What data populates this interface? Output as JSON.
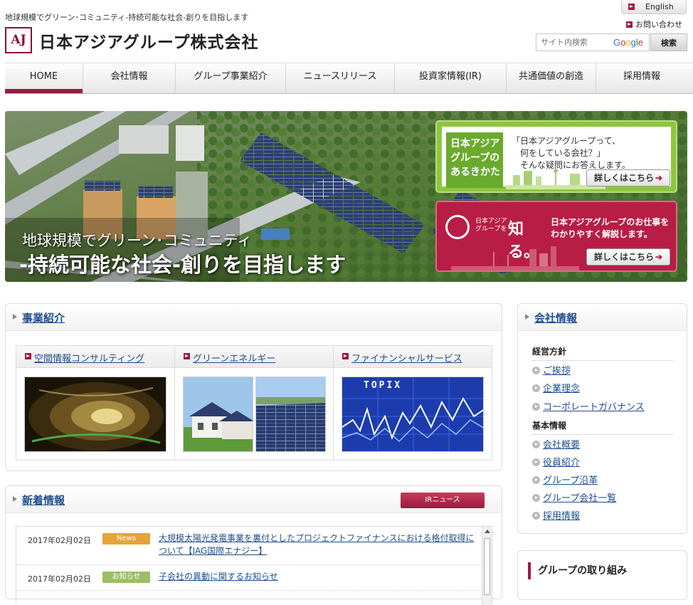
{
  "header": {
    "tagline": "地球規模でグリーン･コミュニティ-持続可能な社会-創りを目指します",
    "logo_mark": "AJ",
    "company_name": "日本アジアグループ株式会社",
    "language_button": "English",
    "contact_link": "お問い合わせ",
    "search": {
      "placeholder": "サイト内検索",
      "provider": "Google",
      "button": "検索"
    }
  },
  "nav": {
    "items": [
      {
        "label": "HOME",
        "active": true
      },
      {
        "label": "会社情報"
      },
      {
        "label": "グループ事業紹介"
      },
      {
        "label": "ニュースリリース"
      },
      {
        "label": "投資家情報(IR)"
      },
      {
        "label": "共通価値の創造"
      },
      {
        "label": "採用情報"
      }
    ]
  },
  "hero": {
    "line1": "地球規模でグリーン･コミュニティ",
    "line2": "-持続可能な社会-創りを目指します",
    "promo_green": {
      "title_lines": [
        "日本アジア",
        "グループの",
        "あるきかた"
      ],
      "desc_lines": [
        "「日本アジアグループって、",
        "　何をしている会社？」",
        "　そんな疑問にお答えします。"
      ],
      "button": "詳しくはこちら"
    },
    "promo_red": {
      "logo_small_lines": [
        "日本アジア",
        "グループを"
      ],
      "logo_big": "知る。",
      "desc_lines": [
        "日本アジアグループのお仕事を",
        "わかりやすく解説します。"
      ],
      "button": "詳しくはこちら"
    }
  },
  "business": {
    "title": "事業紹介",
    "columns": [
      {
        "label": "空間情報コンサルティング"
      },
      {
        "label": "グリーンエネルギー"
      },
      {
        "label": "ファイナンシャルサービス",
        "image_caption": "TOPIX"
      }
    ]
  },
  "news": {
    "title": "新着情報",
    "ir_button": "IRニュース",
    "items": [
      {
        "date": "2017年02月02日",
        "tag": "News",
        "tag_color": "#e5a33c",
        "title": "大規模太陽光発電事業を裏付としたプロジェクトファイナンスにおける格付取得について【JAG国際エナジー】"
      },
      {
        "date": "2017年02月02日",
        "tag": "お知らせ",
        "tag_color": "#9cbf62",
        "title": "子会社の異動に関するお知らせ"
      }
    ]
  },
  "company_info": {
    "title": "会社情報",
    "groups": [
      {
        "heading": "経営方針",
        "links": [
          "ご挨拶",
          "企業理念",
          "コーポレートガバナンス"
        ]
      },
      {
        "heading": "基本情報",
        "links": [
          "会社概要",
          "役員紹介",
          "グループ沿革",
          "グループ会社一覧",
          "採用情報"
        ]
      }
    ]
  },
  "group_initiatives": {
    "title": "グループの取り組み"
  },
  "colors": {
    "accent": "#9b1b3e",
    "link": "#1f4e8c",
    "promo_green": "#8dc63f",
    "promo_red": "#b81d46"
  }
}
